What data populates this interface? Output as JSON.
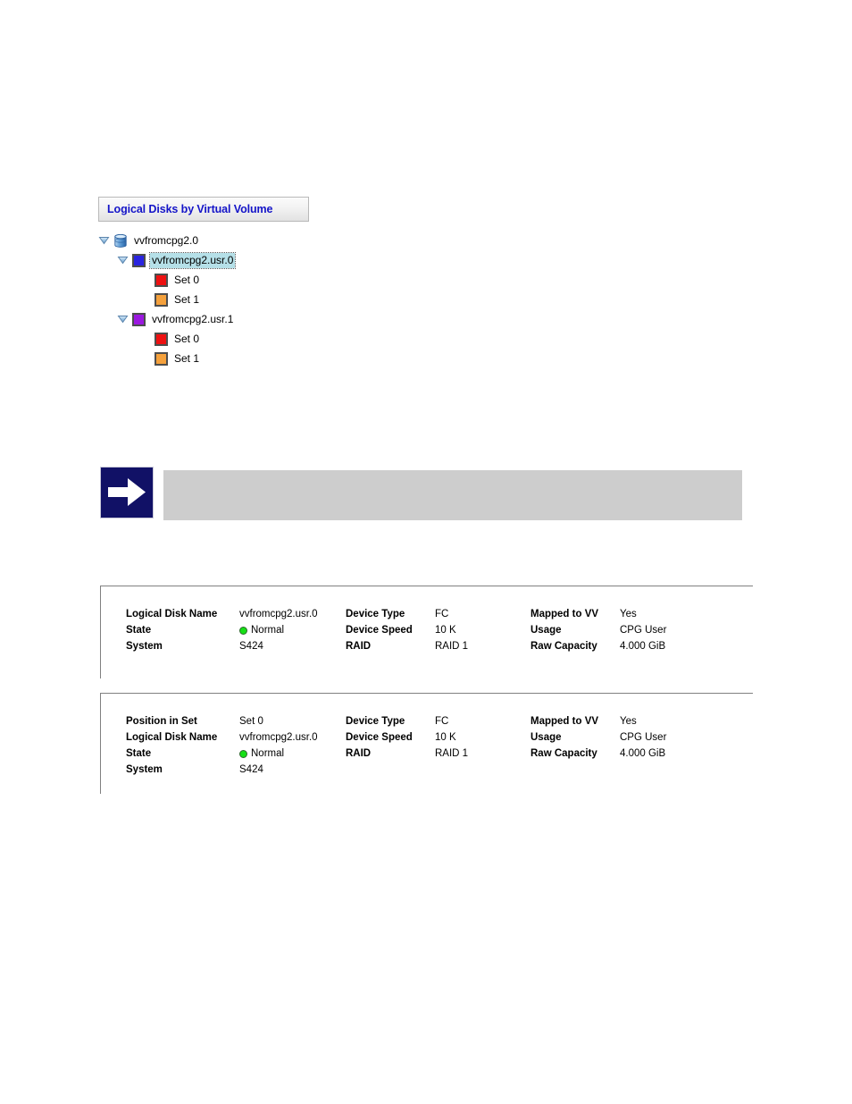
{
  "tree_panel": {
    "header_title": "Logical Disks by Virtual Volume",
    "nodes": [
      {
        "label": "vvfromcpg2.0",
        "icon": "volume-cylinder-icon",
        "level": 0,
        "expanded": true,
        "selected": false
      },
      {
        "label": "vvfromcpg2.usr.0",
        "icon": "blue-square-icon",
        "icon_color": "#2a24e0",
        "level": 1,
        "expanded": true,
        "selected": true
      },
      {
        "label": "Set 0",
        "icon": "red-square-icon",
        "icon_color": "#ee1111",
        "level": 2,
        "expanded": false,
        "selected": false
      },
      {
        "label": "Set 1",
        "icon": "orange-square-icon",
        "icon_color": "#f5a13c",
        "level": 2,
        "expanded": false,
        "selected": false
      },
      {
        "label": "vvfromcpg2.usr.1",
        "icon": "purple-square-icon",
        "icon_color": "#9b18e0",
        "level": 1,
        "expanded": true,
        "selected": false
      },
      {
        "label": "Set 0",
        "icon": "red-square-icon",
        "icon_color": "#ee1111",
        "level": 2,
        "expanded": false,
        "selected": false
      },
      {
        "label": "Set 1",
        "icon": "orange-square-icon",
        "icon_color": "#f5a13c",
        "level": 2,
        "expanded": false,
        "selected": false
      }
    ]
  },
  "note_block": {
    "icon": "arrow-right-note-icon",
    "text": ""
  },
  "detail_panel_1": {
    "columns": [
      {
        "rows": [
          {
            "label": "Logical Disk Name",
            "value": "vvfromcpg2.usr.0"
          },
          {
            "label": "State",
            "value": "Normal",
            "status": "normal"
          },
          {
            "label": "System",
            "value": "S424"
          }
        ]
      },
      {
        "rows": [
          {
            "label": "Device Type",
            "value": "FC"
          },
          {
            "label": "Device Speed",
            "value": "10 K"
          },
          {
            "label": "RAID",
            "value": "RAID 1"
          }
        ]
      },
      {
        "rows": [
          {
            "label": "Mapped to VV",
            "value": "Yes"
          },
          {
            "label": "Usage",
            "value": "CPG User"
          },
          {
            "label": "Raw Capacity",
            "value": "4.000 GiB"
          }
        ]
      }
    ]
  },
  "detail_panel_2": {
    "columns": [
      {
        "rows": [
          {
            "label": "Position in Set",
            "value": "Set 0"
          },
          {
            "label": "Logical Disk Name",
            "value": "vvfromcpg2.usr.0"
          },
          {
            "label": "State",
            "value": "Normal",
            "status": "normal"
          },
          {
            "label": "System",
            "value": "S424"
          }
        ]
      },
      {
        "rows": [
          {
            "label": "Device Type",
            "value": "FC"
          },
          {
            "label": "Device Speed",
            "value": "10 K"
          },
          {
            "label": "RAID",
            "value": "RAID 1"
          }
        ]
      },
      {
        "rows": [
          {
            "label": "Mapped to VV",
            "value": "Yes"
          },
          {
            "label": "Usage",
            "value": "CPG User"
          },
          {
            "label": "Raw Capacity",
            "value": "4.000 GiB"
          }
        ]
      }
    ]
  },
  "colors": {
    "header_text": "#1414c8",
    "selection_bg": "#b5e0e8",
    "status_normal": "#16e016",
    "note_icon_bg": "#111166",
    "note_body_bg": "#cdcdcd"
  }
}
